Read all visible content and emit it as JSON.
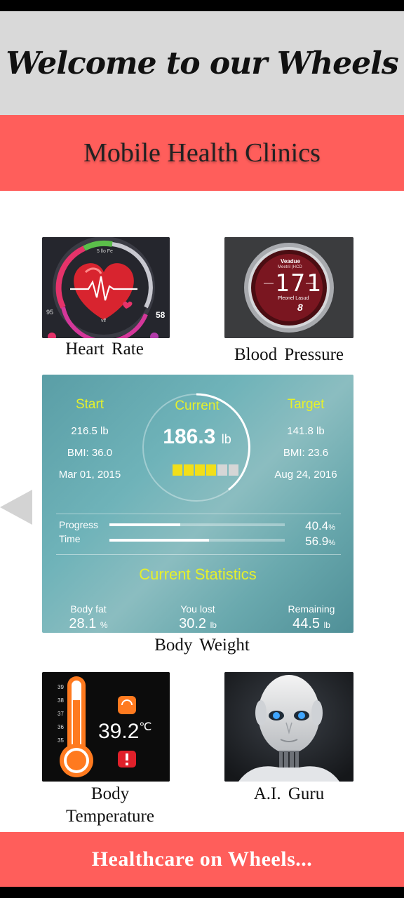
{
  "header": {
    "title": "Welcome to our Wheels"
  },
  "subheader": {
    "title": "Mobile Health Clinics"
  },
  "tiles": {
    "heart_rate": {
      "caption": "Heart  Rate",
      "reading": "58",
      "side": "95",
      "mid_label": "5 llo Fe",
      "low_label": "vlf"
    },
    "blood_pressure": {
      "caption": "Blood  Pressure",
      "reading": "171",
      "top_label": "Veadue",
      "sub_label": "Meetril (HCD",
      "low_value": "8",
      "bottom_label": "Pleonel Lasud"
    },
    "body_weight": {
      "caption": "Body  Weight",
      "start": {
        "label": "Start",
        "weight": "216.5 lb",
        "bmi": "BMI: 36.0",
        "date": "Mar 01, 2015"
      },
      "current": {
        "label": "Current",
        "value": "186.3",
        "unit": "lb",
        "squares_filled": 4,
        "squares_total": 6
      },
      "target": {
        "label": "Target",
        "weight": "141.8 lb",
        "bmi": "BMI: 23.6",
        "date": "Aug 24, 2016"
      },
      "progress": {
        "label": "Progress",
        "value": "40.4",
        "unit": "%",
        "fraction": 0.404
      },
      "time": {
        "label": "Time",
        "value": "56.9",
        "unit": "%",
        "fraction": 0.569
      },
      "stats_title": "Current Statistics",
      "stats": [
        {
          "label": "Body fat",
          "value": "28.1",
          "unit": "%"
        },
        {
          "label": "You lost",
          "value": "30.2",
          "unit": "lb"
        },
        {
          "label": "Remaining",
          "value": "44.5",
          "unit": "lb"
        }
      ]
    },
    "body_temperature": {
      "caption_line1": "Body",
      "caption_line2": "Temperature",
      "value": "39.2",
      "unit": "℃",
      "scale": [
        "39",
        "38",
        "37",
        "36",
        "35"
      ]
    },
    "ai_guru": {
      "caption": "A.I.  Guru"
    }
  },
  "nav": {
    "left_arrow": "previous"
  },
  "footer": {
    "title": "Healthcare on Wheels..."
  },
  "colors": {
    "accent": "#ff5e5b",
    "header_bg": "#d9d9d9",
    "stat_yellow": "#e5f02c"
  }
}
